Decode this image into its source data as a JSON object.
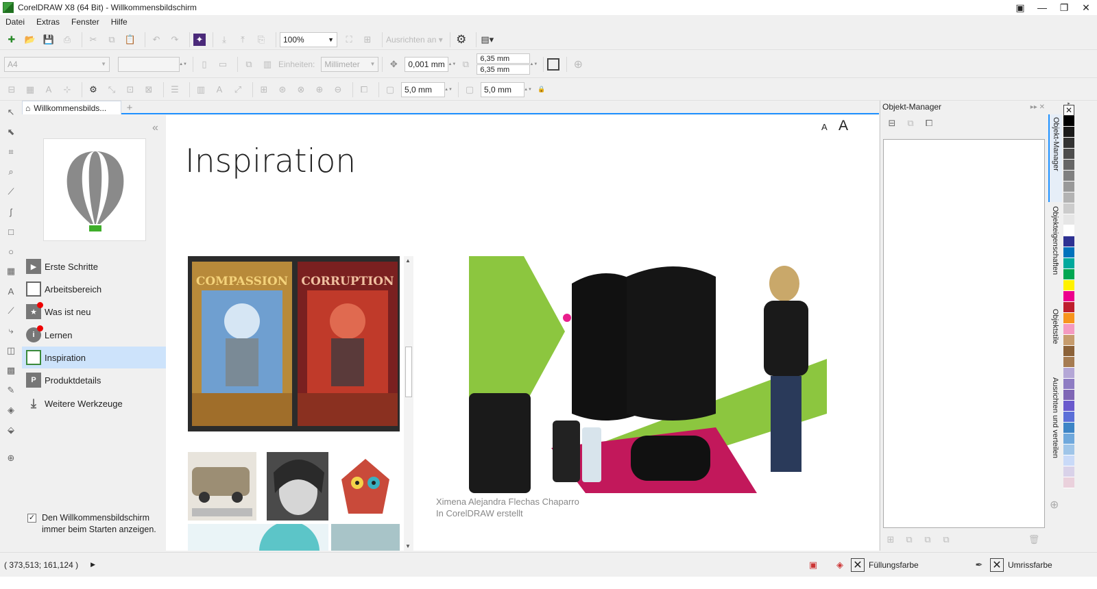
{
  "window": {
    "title": "CorelDRAW X8 (64 Bit) - Willkommensbildschirm"
  },
  "menu": [
    "Datei",
    "Extras",
    "Fenster",
    "Hilfe"
  ],
  "toolbar1": {
    "zoom": "100%",
    "align_label": "Ausrichten an"
  },
  "propbar": {
    "page_size": "A4",
    "units_label": "Einheiten:",
    "units_value": "Millimeter",
    "nudge": "0,001 mm",
    "dup_x": "6,35 mm",
    "dup_y": "6,35 mm"
  },
  "toolbar3": {
    "w": "5,0 mm",
    "h": "5,0 mm"
  },
  "tab": {
    "label": "Willkommensbilds...",
    "add": "+"
  },
  "nav": {
    "items": [
      {
        "label": "Erste Schritte",
        "icon": "play-icon"
      },
      {
        "label": "Arbeitsbereich",
        "icon": "monitor-icon"
      },
      {
        "label": "Was ist neu",
        "icon": "star-icon"
      },
      {
        "label": "Lernen",
        "icon": "info-icon"
      },
      {
        "label": "Inspiration",
        "icon": "image-icon"
      },
      {
        "label": "Produktdetails",
        "icon": "product-icon"
      },
      {
        "label": "Weitere Werkzeuge",
        "icon": "download-icon"
      }
    ],
    "collapse": "«",
    "checkbox_label": "Den Willkommensbildschirm immer beim Starten anzeigen.",
    "checkbox_checked": true
  },
  "content": {
    "title": "Inspiration",
    "font_small": "A",
    "font_large": "A",
    "caption_line1": "Ximena Alejandra Flechas Chaparro",
    "caption_line2": "In CorelDRAW erstellt",
    "thumb1_left": "COMPASSION",
    "thumb1_right": "CORRUPTION"
  },
  "objmgr": {
    "title": "Objekt-Manager"
  },
  "dockers": [
    "Objekt-Manager",
    "Objekteigenschaften",
    "Objektstile",
    "Ausrichten und verteilen"
  ],
  "palette": [
    "#ffffff",
    "#000000",
    "#1a1a1a",
    "#333333",
    "#4d4d4d",
    "#666666",
    "#808080",
    "#999999",
    "#b3b3b3",
    "#cccccc",
    "#e6e6e6",
    "#ffffff",
    "#2e3192",
    "#0072bc",
    "#00a99d",
    "#00a651",
    "#fff200",
    "#ec008c",
    "#be1e2d",
    "#f7941d",
    "#f49ac1",
    "#c69c6d",
    "#8c6239",
    "#a67c52",
    "#b4a7d6",
    "#8e7cc3",
    "#7f66b5",
    "#6a5acd",
    "#5b6fd8",
    "#3d85c6",
    "#6fa8dc",
    "#9fc5e8",
    "#c9daf8",
    "#d9d2e9",
    "#ead1dc"
  ],
  "status": {
    "coords": "( 373,513; 161,124 )",
    "fill_label": "Füllungsfarbe",
    "outline_label": "Umrissfarbe"
  }
}
